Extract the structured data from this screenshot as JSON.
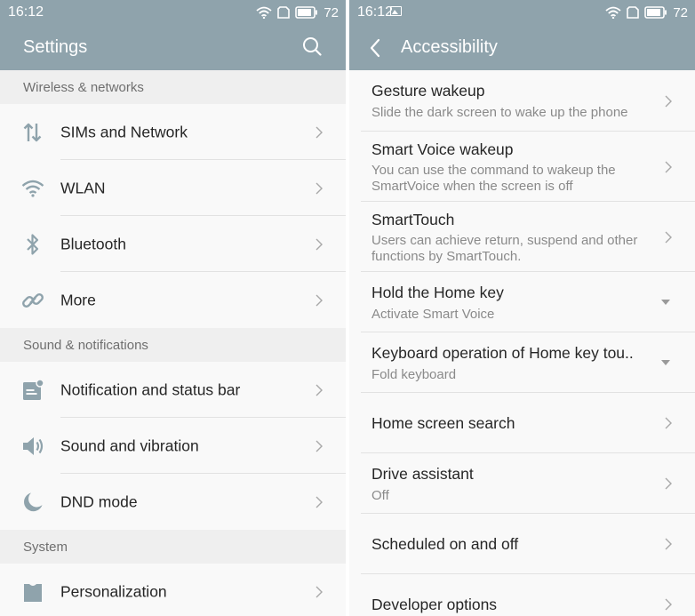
{
  "left": {
    "status": {
      "time": "16:12",
      "battery": "72"
    },
    "title": "Settings",
    "sections": [
      {
        "header": "Wireless & networks",
        "items": [
          {
            "label": "SIMs and Network",
            "icon": "sim-network-icon"
          },
          {
            "label": "WLAN",
            "icon": "wifi-icon"
          },
          {
            "label": "Bluetooth",
            "icon": "bluetooth-icon"
          },
          {
            "label": "More",
            "icon": "link-icon"
          }
        ]
      },
      {
        "header": "Sound & notifications",
        "items": [
          {
            "label": "Notification and status bar",
            "icon": "notification-icon"
          },
          {
            "label": "Sound and vibration",
            "icon": "speaker-icon"
          },
          {
            "label": "DND mode",
            "icon": "moon-icon"
          }
        ]
      },
      {
        "header": "System",
        "items": [
          {
            "label": "Personalization",
            "icon": "personalization-icon"
          }
        ]
      }
    ]
  },
  "right": {
    "status": {
      "time": "16:12",
      "battery": "72"
    },
    "title": "Accessibility",
    "items": [
      {
        "title": "Gesture wakeup",
        "subtitle": "Slide the dark screen to wake up the phone",
        "control": "chevron"
      },
      {
        "title": "Smart Voice wakeup",
        "subtitle": "You can use the command to wakeup the SmartVoice when the screen is off",
        "control": "chevron"
      },
      {
        "title": "SmartTouch",
        "subtitle": "Users can achieve return, suspend and other functions by SmartTouch.",
        "control": "chevron"
      },
      {
        "title": "Hold the Home key",
        "subtitle": "Activate Smart Voice",
        "control": "dropdown"
      },
      {
        "title": "Keyboard operation of Home key tou..",
        "subtitle": "Fold keyboard",
        "control": "dropdown"
      },
      {
        "title": "Home screen search",
        "subtitle": "",
        "control": "chevron"
      },
      {
        "title": "Drive assistant",
        "subtitle": "Off",
        "control": "chevron"
      },
      {
        "title": "Scheduled on and off",
        "subtitle": "",
        "control": "chevron"
      },
      {
        "title": "Developer options",
        "subtitle": "",
        "control": "chevron"
      }
    ]
  },
  "colors": {
    "header": "#8fa3ac",
    "icon": "#8fa3ac",
    "section_bg": "#efefef",
    "text": "#262626",
    "subtext": "#8a8a8a"
  }
}
